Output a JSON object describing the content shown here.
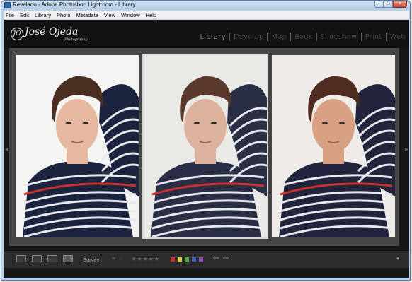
{
  "window": {
    "title": "Revelado - Adobe Photoshop Lightroom - Library",
    "minimize": "–",
    "maximize": "□",
    "close": "✕"
  },
  "menu": [
    "File",
    "Edit",
    "Library",
    "Photo",
    "Metadata",
    "View",
    "Window",
    "Help"
  ],
  "identity": {
    "monogram": "JO",
    "name": "José Ojeda",
    "tagline": "Photography"
  },
  "modules": [
    "Library",
    "Develop",
    "Map",
    "Book",
    "Slideshow",
    "Print",
    "Web"
  ],
  "active_module": "Library",
  "toolbar": {
    "survey_label": "Survey :",
    "stars": "★★★★★",
    "flag_pick": "⚑",
    "flag_reject": "⚐",
    "prev_arrow": "⇦",
    "next_arrow": "⇨",
    "menu_arrow": "▼"
  },
  "color_labels": [
    "#c8322a",
    "#d8c43a",
    "#4fa53a",
    "#3e62c9",
    "#8a49b3"
  ],
  "photos": [
    {
      "variant": "bright",
      "selected": false
    },
    {
      "variant": "soft",
      "selected": true
    },
    {
      "variant": "warm",
      "selected": false
    }
  ]
}
